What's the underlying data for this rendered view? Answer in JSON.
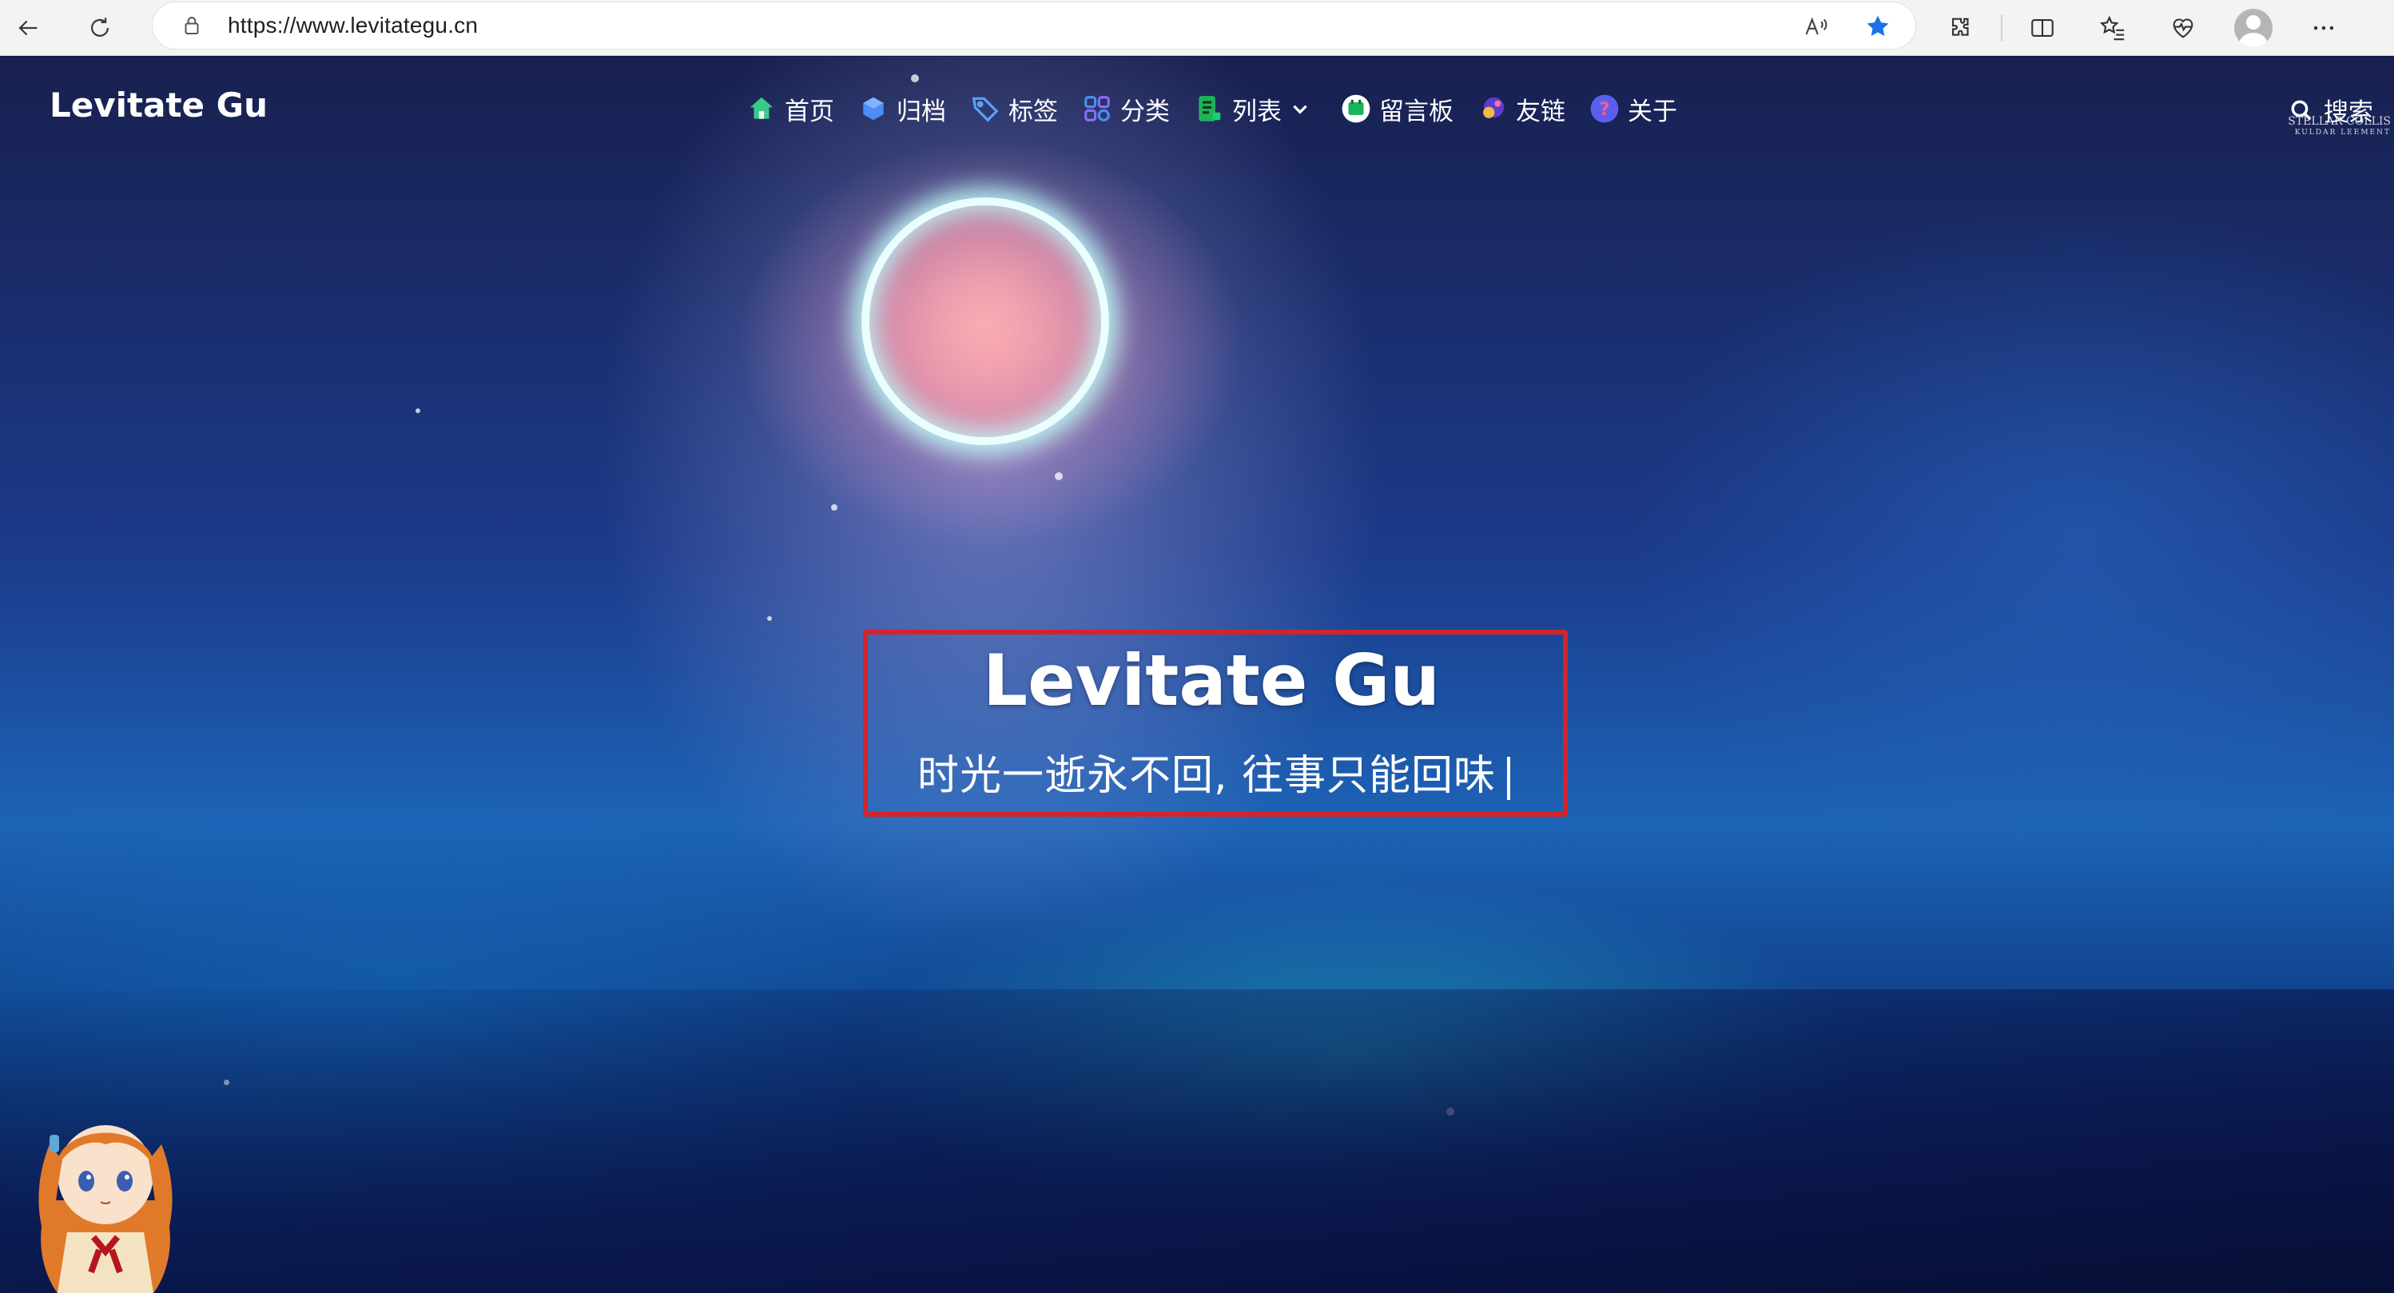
{
  "browser": {
    "url": "https://www.levitategu.cn",
    "back_label": "Back",
    "refresh_label": "Refresh"
  },
  "site": {
    "brand": "Levitate Gu",
    "nav": [
      {
        "label": "首页",
        "icon": "home-icon"
      },
      {
        "label": "归档",
        "icon": "archive-cube-icon"
      },
      {
        "label": "标签",
        "icon": "tag-icon"
      },
      {
        "label": "分类",
        "icon": "category-grid-icon"
      },
      {
        "label": "列表",
        "icon": "list-icon",
        "dropdown": true
      },
      {
        "label": "留言板",
        "icon": "message-board-icon"
      },
      {
        "label": "友链",
        "icon": "friend-link-icon"
      },
      {
        "label": "关于",
        "icon": "about-question-icon"
      }
    ],
    "search_label": "搜索",
    "corner_text": [
      "STELLAR COLLIS",
      "KULDAR LEEMENT"
    ]
  },
  "hero": {
    "title": "Levitate Gu",
    "subtitle": "时光一逝永不回, 往事只能回味"
  },
  "colors": {
    "highlight_box": "#d3242a",
    "favorite_star": "#1a73e8"
  }
}
